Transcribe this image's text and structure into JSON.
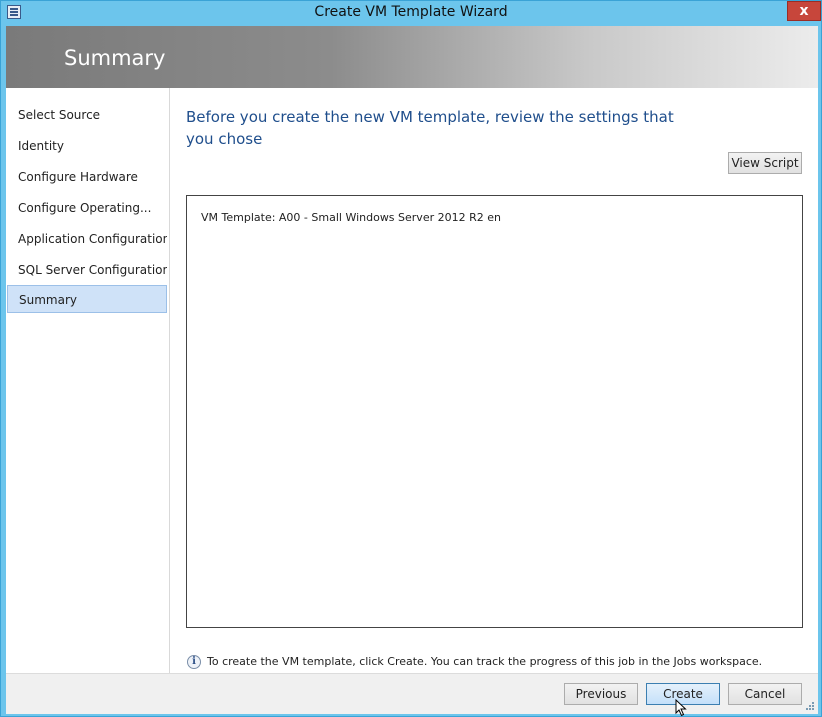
{
  "window": {
    "title": "Create VM Template Wizard",
    "close_glyph": "x"
  },
  "banner": {
    "title": "Summary"
  },
  "nav": {
    "items": [
      {
        "label": "Select Source"
      },
      {
        "label": "Identity"
      },
      {
        "label": "Configure Hardware"
      },
      {
        "label": "Configure Operating..."
      },
      {
        "label": "Application Configuration"
      },
      {
        "label": "SQL Server Configuration"
      },
      {
        "label": "Summary",
        "selected": true
      }
    ]
  },
  "main": {
    "heading": "Before you create the new VM template, review the settings that you chose",
    "view_script_label": "View Script",
    "summary_line": "VM Template: A00 - Small Windows Server 2012 R2 en",
    "info_text": "To create the VM template, click Create. You can track the progress of this job in the Jobs workspace."
  },
  "footer": {
    "previous_label": "Previous",
    "create_label": "Create",
    "cancel_label": "Cancel"
  },
  "icons": {
    "app": "window-menu-icon",
    "info": "info-icon",
    "cursor": "mouse-pointer-icon",
    "grip": "resize-grip-icon"
  },
  "colors": {
    "window_frame": "#6cc5ec",
    "heading": "#1f4e8c",
    "selected_nav": "#cfe2f8",
    "close_button": "#c7463b"
  }
}
